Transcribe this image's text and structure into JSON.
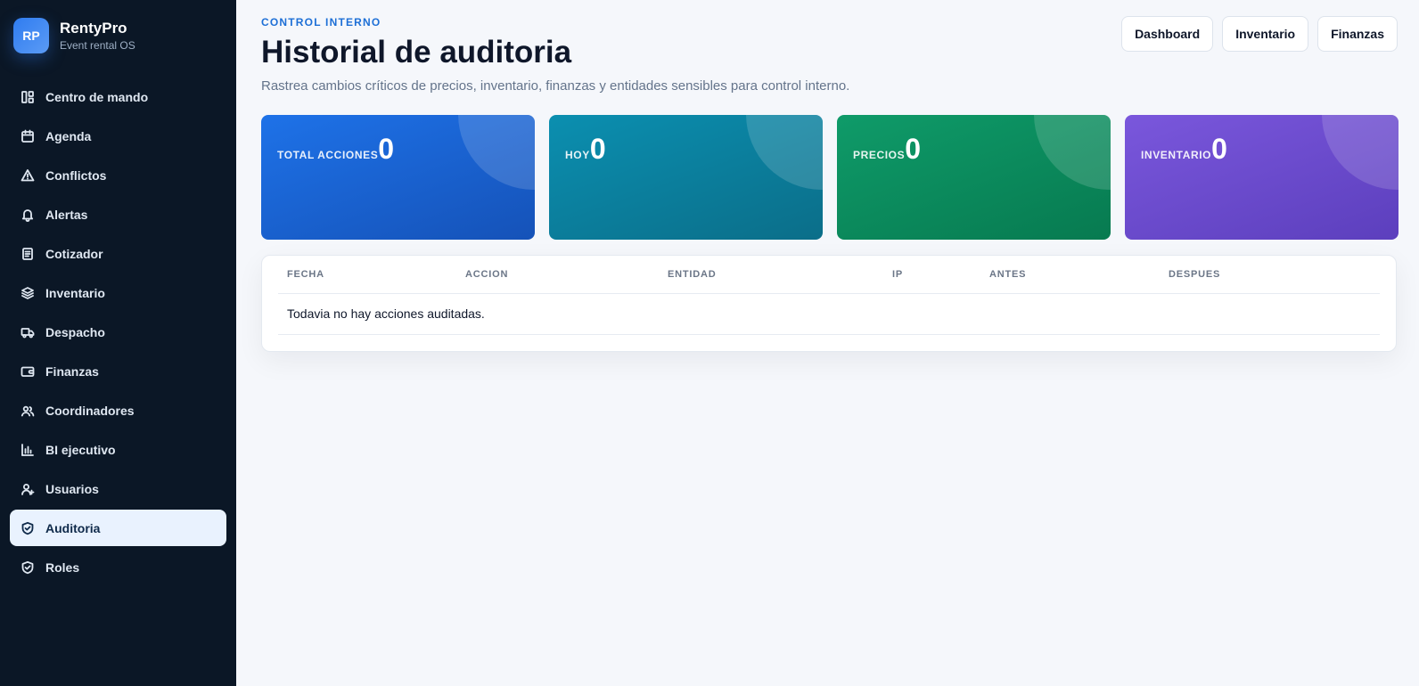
{
  "brand": {
    "logo": "RP",
    "name": "RentyPro",
    "subtitle": "Event rental OS"
  },
  "sidebar": {
    "items": [
      {
        "label": "Centro de mando",
        "icon": "layout-icon"
      },
      {
        "label": "Agenda",
        "icon": "calendar-icon"
      },
      {
        "label": "Conflictos",
        "icon": "warning-icon"
      },
      {
        "label": "Alertas",
        "icon": "bell-icon"
      },
      {
        "label": "Cotizador",
        "icon": "document-icon"
      },
      {
        "label": "Inventario",
        "icon": "layers-icon"
      },
      {
        "label": "Despacho",
        "icon": "truck-icon"
      },
      {
        "label": "Finanzas",
        "icon": "wallet-icon"
      },
      {
        "label": "Coordinadores",
        "icon": "users-icon"
      },
      {
        "label": "BI ejecutivo",
        "icon": "bar-chart-icon"
      },
      {
        "label": "Usuarios",
        "icon": "user-plus-icon"
      },
      {
        "label": "Auditoria",
        "icon": "shield-check-icon",
        "active": true
      },
      {
        "label": "Roles",
        "icon": "shield-check-icon"
      }
    ]
  },
  "header": {
    "eyebrow": "CONTROL INTERNO",
    "title": "Historial de auditoria",
    "subtitle": "Rastrea cambios críticos de precios, inventario, finanzas y entidades sensibles para control interno."
  },
  "actions": {
    "dashboard": "Dashboard",
    "inventario": "Inventario",
    "finanzas": "Finanzas"
  },
  "stats": [
    {
      "label": "TOTAL ACCIONES",
      "value": "0",
      "color": "#1e72e8"
    },
    {
      "label": "HOY",
      "value": "0",
      "color": "#0b8fb0"
    },
    {
      "label": "PRECIOS",
      "value": "0",
      "color": "#0f9b69"
    },
    {
      "label": "INVENTARIO",
      "value": "0",
      "color": "#7a57dc"
    }
  ],
  "table": {
    "columns": [
      "FECHA",
      "ACCION",
      "ENTIDAD",
      "IP",
      "ANTES",
      "DESPUES"
    ],
    "empty_message": "Todavia no hay acciones auditadas."
  }
}
